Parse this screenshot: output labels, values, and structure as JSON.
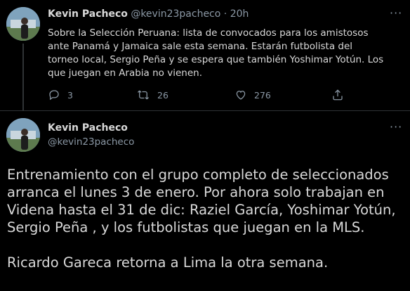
{
  "tweets": [
    {
      "author_name": "Kevin Pacheco",
      "author_handle": "@kevin23pacheco",
      "separator": "·",
      "time": "20h",
      "text": "Sobre la Selección Peruana: lista de convocados para los amistosos ante Panamá y Jamaica sale esta semana. Estarán futbolista del torneo local, Sergio Peña y se espera que también Yoshimar Yotún. Los que juegan en Arabia no vienen.",
      "reply_count": "3",
      "retweet_count": "26",
      "like_count": "276"
    },
    {
      "author_name": "Kevin Pacheco",
      "author_handle": "@kevin23pacheco",
      "text_paragraph_1": "Entrenamiento con el grupo completo de seleccionados arranca el lunes 3 de enero. Por ahora solo trabajan en Videna hasta el 31 de dic: Raziel García, Yoshimar Yotún, Sergio Peña , y los futbolistas que juegan en la MLS.",
      "text_paragraph_2": "Ricardo Gareca retorna a Lima la otra semana."
    }
  ],
  "more_glyph": "···",
  "colors": {
    "background": "#000000",
    "text": "#d9d9d9",
    "muted": "#8b98a5",
    "divider": "#2f3336"
  }
}
